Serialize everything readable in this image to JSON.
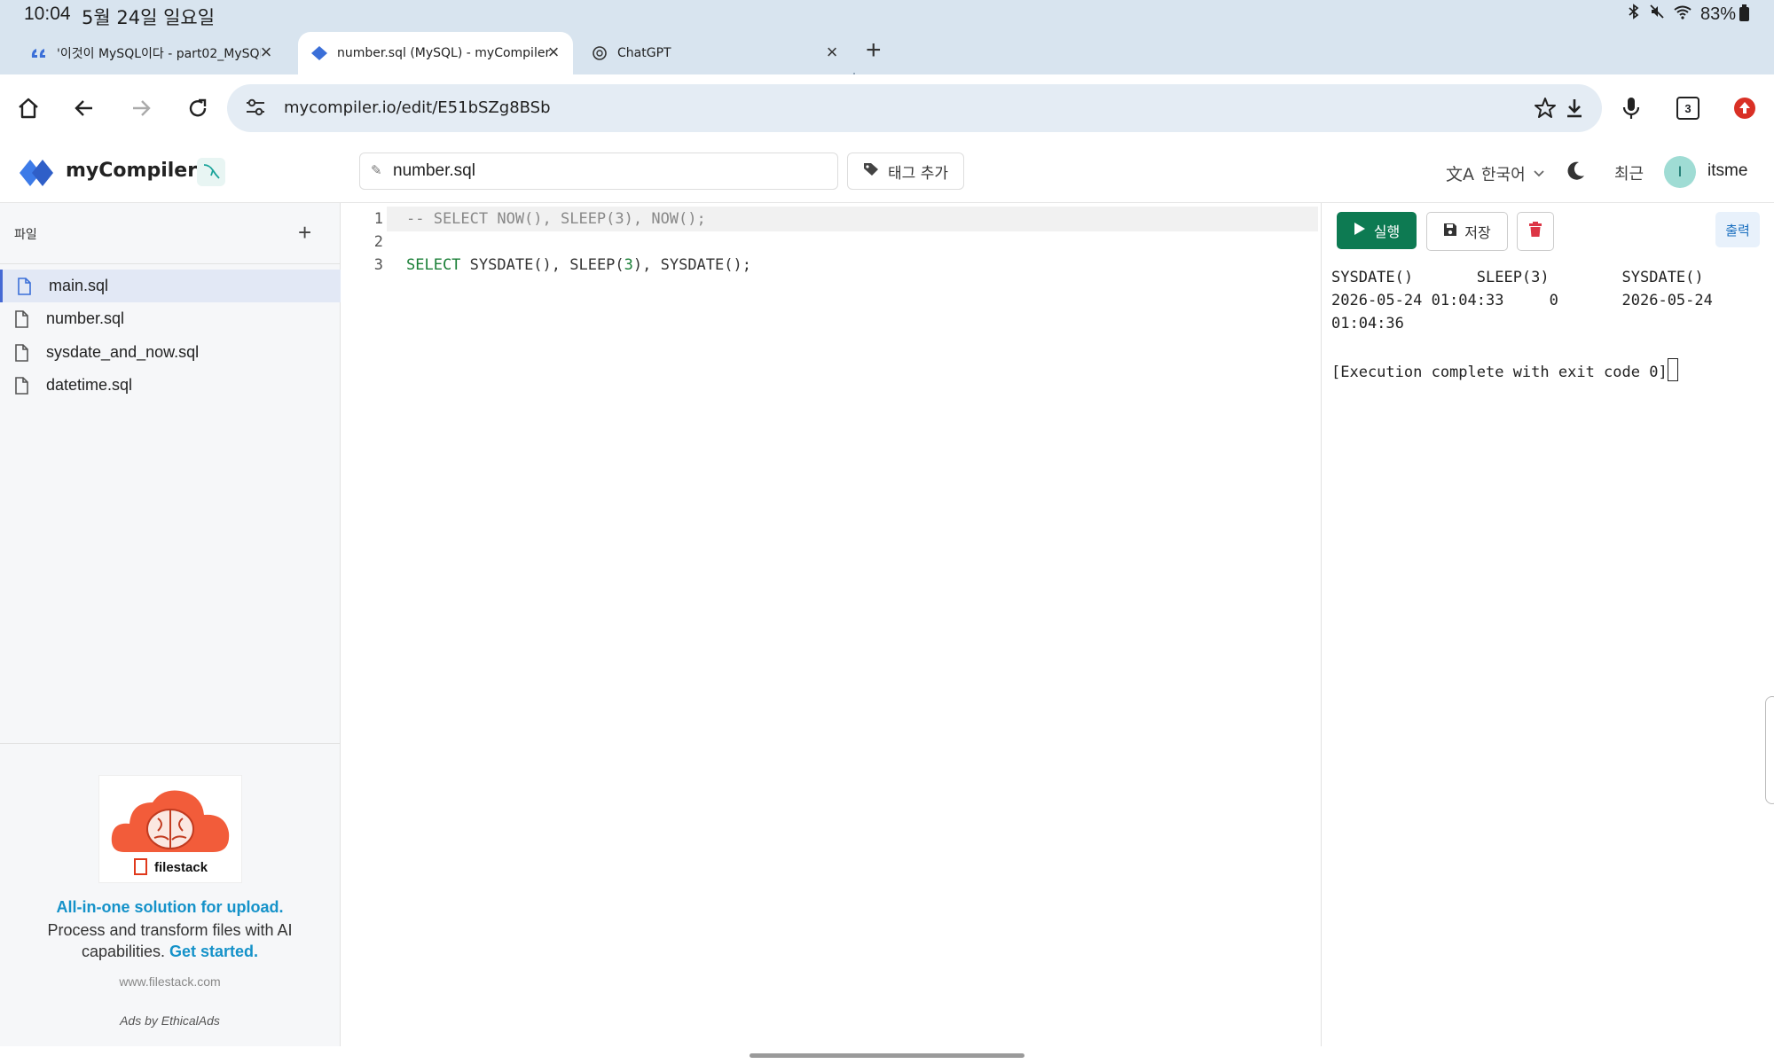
{
  "status": {
    "time": "10:04",
    "date": "5월 24일 일요일",
    "battery": "83%"
  },
  "tabs": [
    {
      "title": "'이것이 MySQL이다 - part02_MySQL 기",
      "active": false
    },
    {
      "title": "number.sql (MySQL) - myCompiler",
      "active": true
    },
    {
      "title": "ChatGPT",
      "active": false
    }
  ],
  "toolbar": {
    "url": "mycompiler.io/edit/E51bSZg8BSb",
    "tab_count": "3"
  },
  "app": {
    "brand": "myCompiler",
    "filename": "number.sql",
    "tag_button": "태그 추가",
    "language": "한국어",
    "recent": "최근",
    "avatar_initial": "I",
    "username": "itsme"
  },
  "sidebar": {
    "heading": "파일",
    "files": [
      "main.sql",
      "number.sql",
      "sysdate_and_now.sql",
      "datetime.sql"
    ],
    "ad": {
      "logo_text": "filestack",
      "title": "All-in-one solution for upload.",
      "body": "Process and transform files with AI capabilities.",
      "cta": "Get started.",
      "url": "www.filestack.com",
      "by": "Ads by EthicalAds"
    }
  },
  "editor": {
    "line_numbers": [
      "1",
      "2",
      "3"
    ],
    "line1": "-- SELECT NOW(), SLEEP(3), NOW();",
    "line3_kw": "SELECT",
    "line3_a": " SYSDATE(), SLEEP(",
    "line3_num": "3",
    "line3_b": "), SYSDATE();"
  },
  "output": {
    "run_label": "실행",
    "save_label": "저장",
    "tab_label": "출력",
    "header": "SYSDATE()       SLEEP(3)        SYSDATE()",
    "row1": "2026-05-24 01:04:33     0       2026-05-24",
    "row2": "01:04:36",
    "exit": "[Execution complete with exit code 0]"
  }
}
